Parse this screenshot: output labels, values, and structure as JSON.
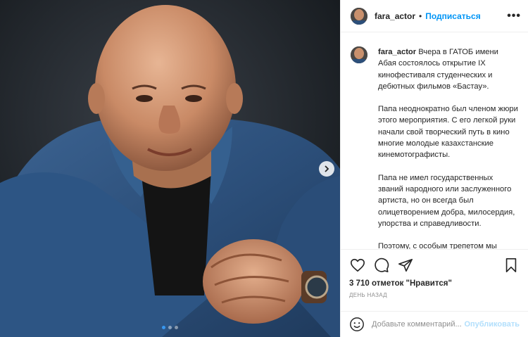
{
  "post": {
    "photo_alt": "portrait photo"
  },
  "header": {
    "username": "fara_actor",
    "separator": "•",
    "follow_label": "Подписаться",
    "more_label": "•••"
  },
  "caption": {
    "username": "fara_actor",
    "paragraphs": [
      "Вчера в ГАТОБ имени Абая состоялось открытие IX кинофестиваля студенческих и дебютных фильмов «Бастау».",
      "Папа неоднократно был членом жюри этого мероприятия. С его легкой руки начали свой творческий путь в кино многие молодые казахстанские кинемотографисты.",
      "Папа не имел государственных званий народного или заслуженного артиста, но он всегда был олицетворением добра, милосердия, упорства и справедливости.",
      "Поэтому, с особым трепетом мы получили награду папы «За особый"
    ]
  },
  "actions": {
    "icons": [
      "heart-icon",
      "comment-icon",
      "share-icon",
      "bookmark-icon"
    ],
    "likes_text": "3 710 отметок \"Нравится\"",
    "time_text": "ДЕНЬ НАЗАД"
  },
  "comment_box": {
    "placeholder": "Добавьте комментарий...",
    "post_label": "Опубликовать"
  },
  "colors": {
    "accent": "#0095f6",
    "post_disabled": "#b2dffc",
    "text": "#262626",
    "muted": "#8e8e8e",
    "carousel_active_dot": "#3897f0"
  }
}
